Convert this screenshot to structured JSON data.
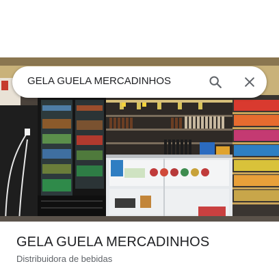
{
  "search": {
    "query": "GELA GUELA MERCADINHOS"
  },
  "place": {
    "name": "GELA GUELA MERCADINHOS",
    "category": "Distribuidora de bebidas"
  },
  "icons": {
    "search": "search-icon",
    "close": "close-icon"
  },
  "colors": {
    "text_primary": "#202124",
    "text_secondary": "#5f6368",
    "icon": "#5f6368"
  }
}
